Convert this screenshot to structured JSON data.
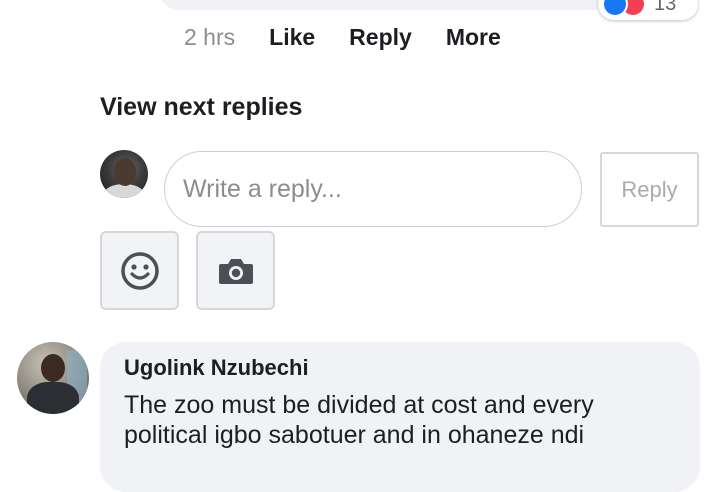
{
  "previous_comment": {
    "reaction_count": "13",
    "reaction_icons": [
      "like-icon",
      "love-icon"
    ],
    "time": "2 hrs",
    "actions": [
      "Like",
      "Reply",
      "More"
    ]
  },
  "view_next_replies": "View next replies",
  "reply_box": {
    "placeholder": "Write a reply...",
    "submit_label": "Reply",
    "tools": [
      "emoji-icon",
      "camera-icon"
    ]
  },
  "comment": {
    "author": "Ugolink Nzubechi",
    "text": "The zoo must be divided at cost and every political igbo sabotuer and in ohaneze ndi"
  },
  "colors": {
    "like": "#1877f2",
    "love": "#f33e58",
    "bubble": "#f0f2f5",
    "muted_text": "#8a8d91"
  }
}
